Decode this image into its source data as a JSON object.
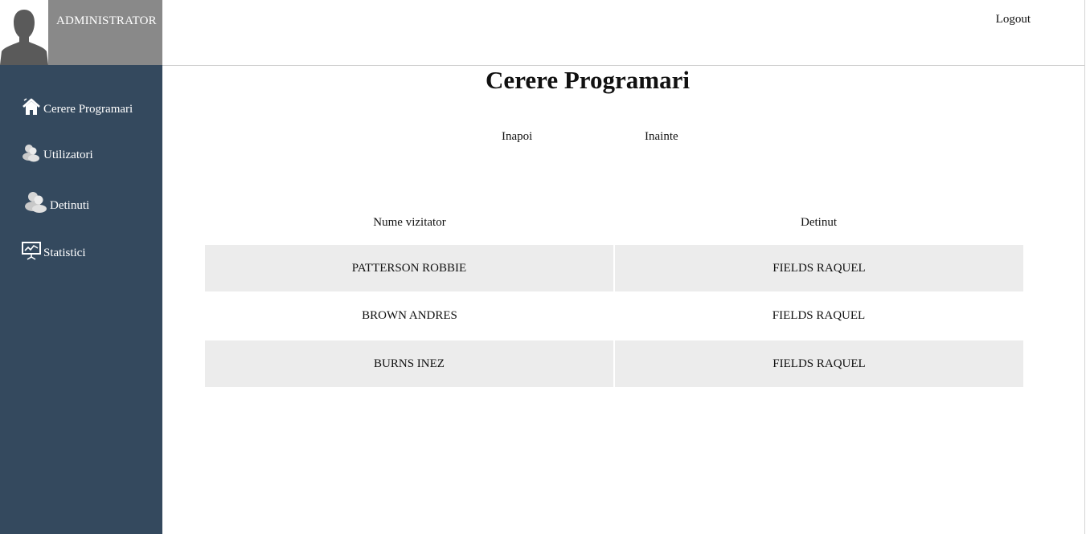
{
  "user": {
    "name": "ADMINISTRATOR",
    "avatar_icon": "user-silhouette-icon"
  },
  "header": {
    "logout_label": "Logout"
  },
  "sidebar": {
    "items": [
      {
        "label": "Cerere Programari",
        "icon": "home-icon"
      },
      {
        "label": "Utilizatori",
        "icon": "users-icon"
      },
      {
        "label": "Detinuti",
        "icon": "group-icon"
      },
      {
        "label": "Statistici",
        "icon": "presentation-chart-icon"
      }
    ]
  },
  "main": {
    "title": "Cerere Programari",
    "pager": {
      "prev_label": "Inapoi",
      "next_label": "Inainte"
    },
    "table": {
      "columns": [
        "Nume vizitator",
        "Detinut"
      ],
      "rows": [
        [
          "PATTERSON ROBBIE",
          "FIELDS RAQUEL"
        ],
        [
          "BROWN ANDRES",
          "FIELDS RAQUEL"
        ],
        [
          "BURNS INEZ",
          "FIELDS RAQUEL"
        ]
      ]
    }
  },
  "colors": {
    "sidebar_bg": "#34495e",
    "user_block_bg": "#898989",
    "row_stripe": "#ececec"
  }
}
